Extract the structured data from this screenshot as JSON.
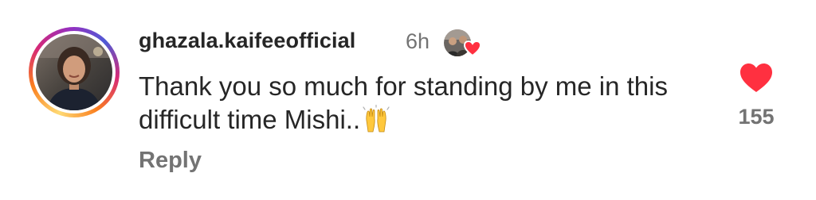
{
  "comment": {
    "username": "ghazala.kaifeeofficial",
    "timestamp": "6h",
    "text": "Thank you so much for standing by me in this difficult time Mishi..",
    "emoji": "raising-hands-emoji",
    "reply_label": "Reply",
    "like_count": "155",
    "avatar_icon": "profile-photo",
    "liked_badge_icon": "author-liked-badge",
    "like_icon": "heart-icon"
  },
  "colors": {
    "heart": "#ff3040",
    "text": "#262626",
    "secondary": "#737373"
  }
}
